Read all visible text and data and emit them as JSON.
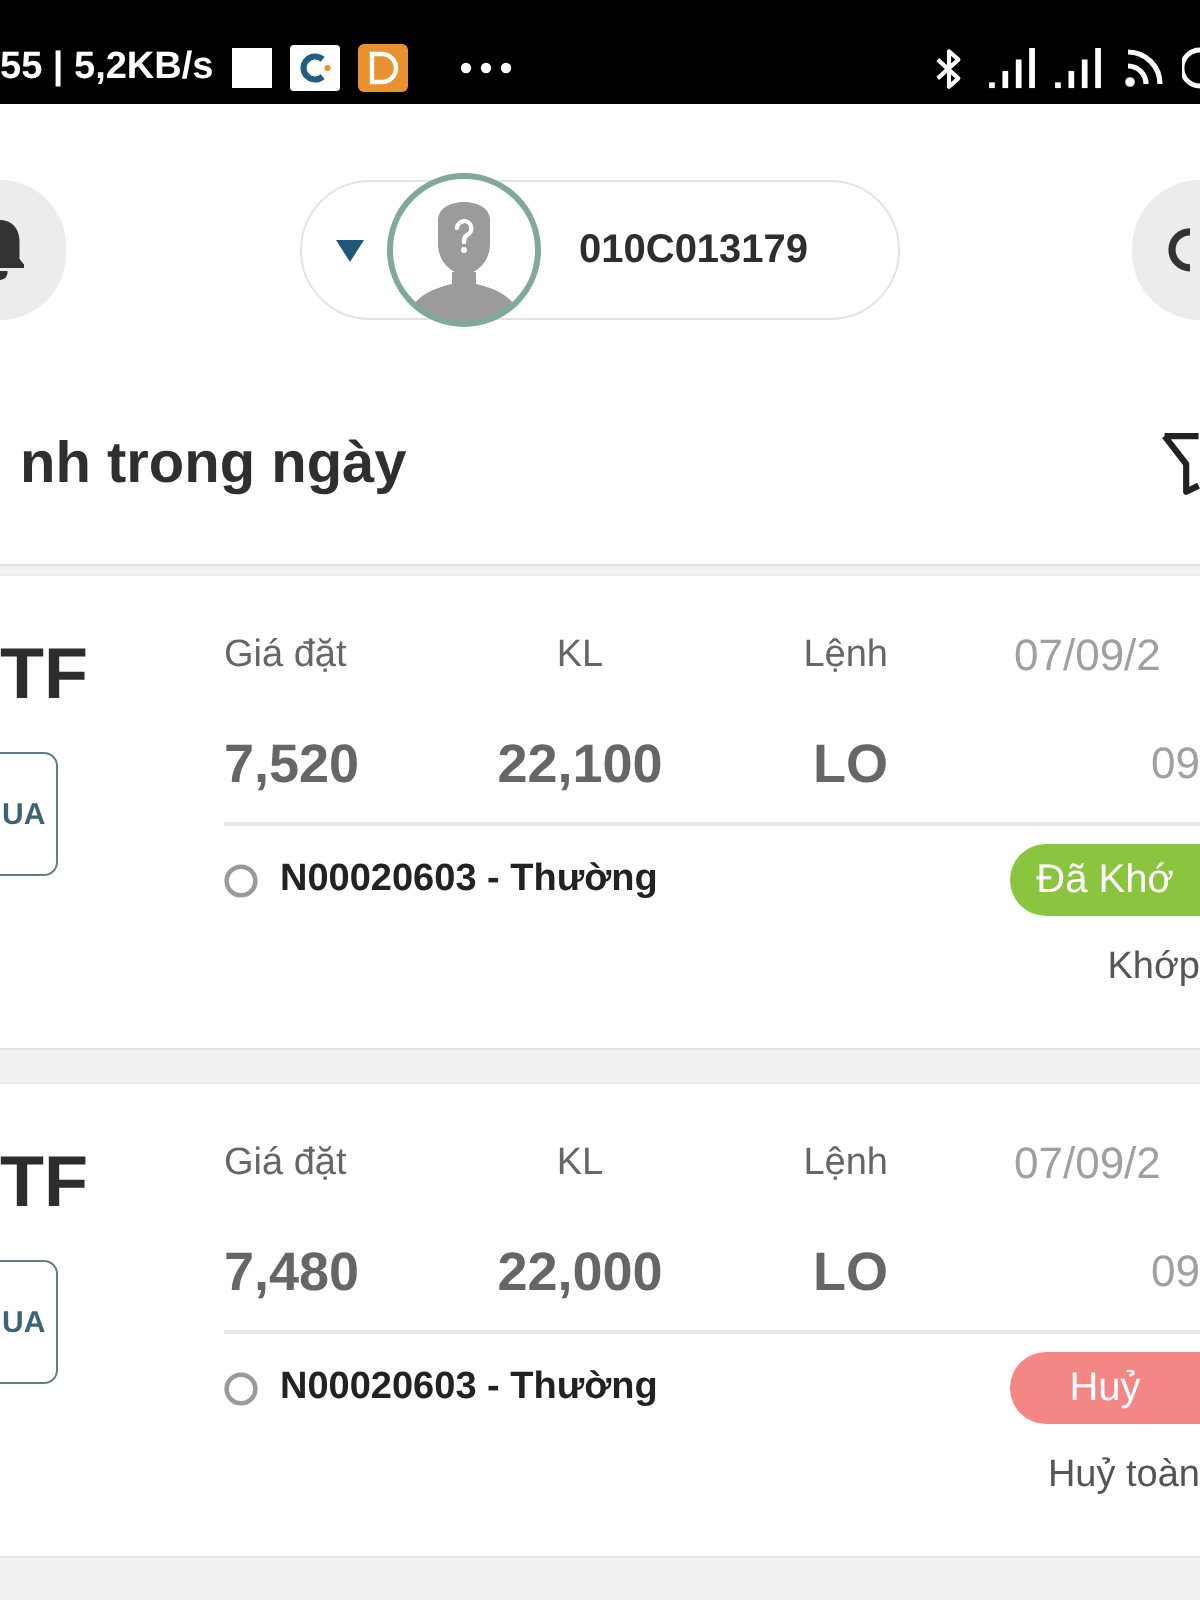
{
  "status_bar": {
    "text": "55 | 5,2KB/s"
  },
  "header": {
    "account": "010C013179"
  },
  "title": "nh trong ngày",
  "orders": [
    {
      "symbol": "TF",
      "side": "UA",
      "price_label": "Giá đặt",
      "price": "7,520",
      "volume_label": "KL",
      "volume": "22,100",
      "type_label": "Lệnh",
      "type": "LO",
      "date": "07/09/2",
      "time": "09",
      "order_ref": "N00020603 - Thường",
      "status": {
        "label": "Đã Khớ",
        "color": "#8bc540"
      },
      "status_detail": "Khớp"
    },
    {
      "symbol": "TF",
      "side": "UA",
      "price_label": "Giá đặt",
      "price": "7,480",
      "volume_label": "KL",
      "volume": "22,000",
      "type_label": "Lệnh",
      "type": "LO",
      "date": "07/09/2",
      "time": "09",
      "order_ref": "N00020603 - Thường",
      "status": {
        "label": "Huỷ",
        "color": "#f48686"
      },
      "status_detail": "Huỷ toàn"
    }
  ]
}
